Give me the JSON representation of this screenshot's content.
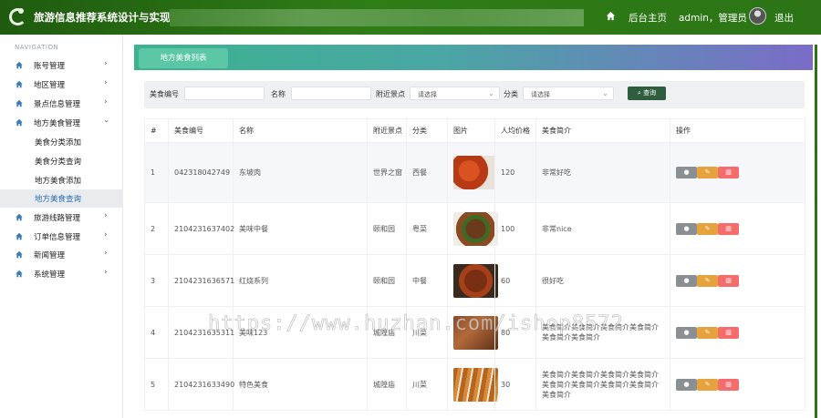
{
  "topbar": {
    "title": "旅游信息推荐系统设计与实现",
    "home": "后台主页",
    "user": "admin，管理员",
    "logout": "退出"
  },
  "sidebar": {
    "heading": "NAVIGATION",
    "items": [
      {
        "label": "账号管理"
      },
      {
        "label": "地区管理"
      },
      {
        "label": "景点信息管理"
      },
      {
        "label": "地方美食管理"
      },
      {
        "label": "旅游线路管理"
      },
      {
        "label": "订单信息管理"
      },
      {
        "label": "新闻管理"
      },
      {
        "label": "系统管理"
      }
    ],
    "subitems": [
      {
        "label": "美食分类添加"
      },
      {
        "label": "美食分类查询"
      },
      {
        "label": "地方美食添加"
      },
      {
        "label": "地方美食查询"
      }
    ]
  },
  "page": {
    "tab": "地方美食列表"
  },
  "search": {
    "code_label": "美食编号",
    "name_label": "名称",
    "spot_label": "附近景点",
    "spot_value": "请选择",
    "cat_label": "分类",
    "cat_value": "请选择",
    "query": "查询"
  },
  "table": {
    "headers": [
      "#",
      "美食编号",
      "名称",
      "附近景点",
      "分类",
      "图片",
      "人均价格",
      "美食简介",
      "操作"
    ],
    "rows": [
      {
        "no": "1",
        "code": "042318042749",
        "name": "东坡肉",
        "spot": "世界之窗",
        "cat": "西餐",
        "price": "120",
        "desc": "非常好吃"
      },
      {
        "no": "2",
        "code": "2104231637402",
        "name": "美味中餐",
        "spot": "颐和园",
        "cat": "粤菜",
        "price": "100",
        "desc": "非常nice"
      },
      {
        "no": "3",
        "code": "2104231636571",
        "name": "红烧系列",
        "spot": "颐和园",
        "cat": "中餐",
        "price": "60",
        "desc": "很好吃"
      },
      {
        "no": "4",
        "code": "2104231635311",
        "name": "美味123",
        "spot": "城隍庙",
        "cat": "川菜",
        "price": "80",
        "desc": "美食简介美食简介美食简介美食简介美食简介美食简介"
      },
      {
        "no": "5",
        "code": "2104231633490",
        "name": "特色美食",
        "spot": "城隍庙",
        "cat": "川菜",
        "price": "30",
        "desc": "美食简介美食简介美食简介美食简介美食简介美食简介美食简介美食简介美食简介"
      }
    ]
  },
  "watermark": "https://www.huzhan.com/ishop8572"
}
